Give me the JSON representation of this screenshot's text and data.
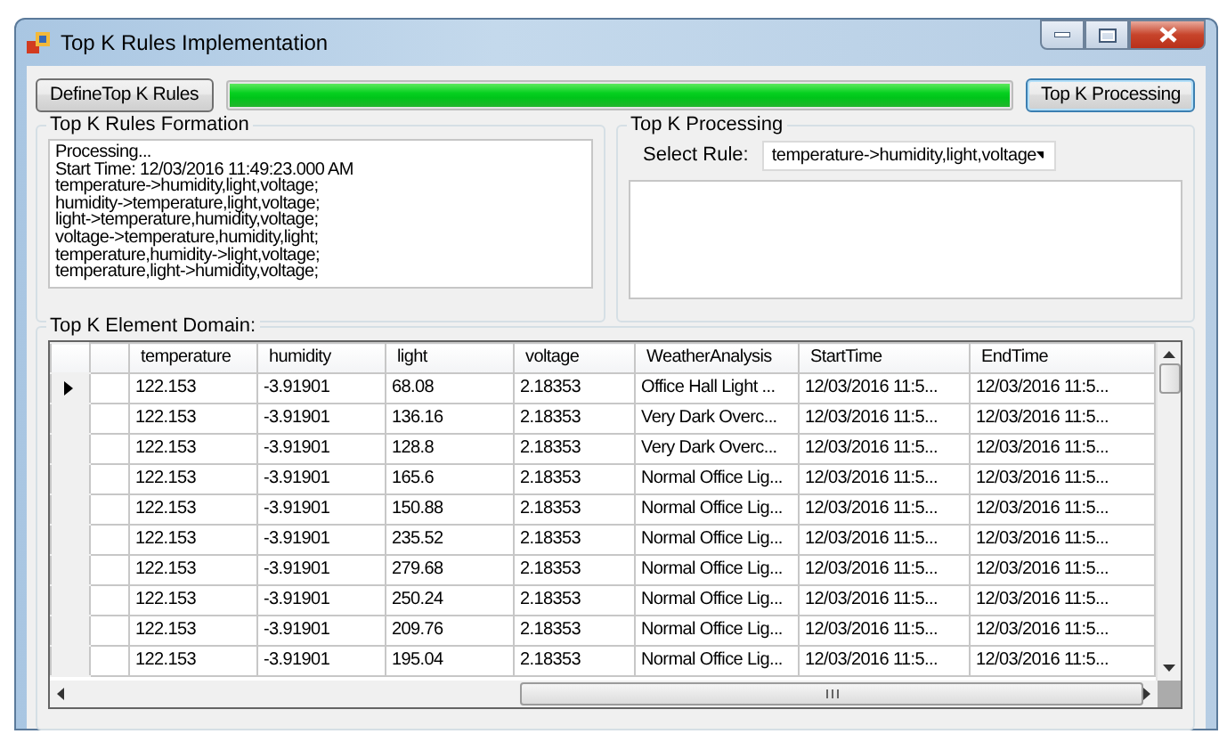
{
  "window": {
    "title": "Top K Rules Implementation"
  },
  "toolbar": [
    {
      "kind": "button",
      "label": "DefineTop K Rules",
      "focused": false
    },
    {
      "kind": "progress",
      "level": 1
    },
    {
      "kind": "button",
      "label": "Top K Processing",
      "focused": true
    }
  ],
  "rules_formation": {
    "title": "Top K Rules Formation",
    "log_lines": [
      "Processing...",
      "Start Time: 12/03/2016 11:49:23.000 AM",
      "temperature->humidity,light,voltage;",
      "humidity->temperature,light,voltage;",
      "light->temperature,humidity,voltage;",
      "voltage->temperature,humidity,light;",
      "temperature,humidity->light,voltage;",
      "temperature,light->humidity,voltage;"
    ]
  },
  "top_k_processing": {
    "title": "Top K Processing",
    "select_label": "Select Rule:",
    "select_value": "temperature->humidity,light,voltage"
  },
  "element_domain": {
    "title": "Top K Element Domain:",
    "table": {
      "columns": [
        "temperature",
        "humidity",
        "light",
        "voltage",
        "WeatherAnalysis",
        "StartTime",
        "EndTime"
      ],
      "rows": [
        {
          "current": true,
          "cells": [
            "122.153",
            "-3.91901",
            "68.08",
            "2.18353",
            "Office Hall Light ...",
            "12/03/2016 11:5...",
            "12/03/2016 11:5..."
          ]
        },
        {
          "current": false,
          "cells": [
            "122.153",
            "-3.91901",
            "136.16",
            "2.18353",
            "Very Dark Overc...",
            "12/03/2016 11:5...",
            "12/03/2016 11:5..."
          ]
        },
        {
          "current": false,
          "cells": [
            "122.153",
            "-3.91901",
            "128.8",
            "2.18353",
            "Very Dark Overc...",
            "12/03/2016 11:5...",
            "12/03/2016 11:5..."
          ]
        },
        {
          "current": false,
          "cells": [
            "122.153",
            "-3.91901",
            "165.6",
            "2.18353",
            "Normal Office Lig...",
            "12/03/2016 11:5...",
            "12/03/2016 11:5..."
          ]
        },
        {
          "current": false,
          "cells": [
            "122.153",
            "-3.91901",
            "150.88",
            "2.18353",
            "Normal Office Lig...",
            "12/03/2016 11:5...",
            "12/03/2016 11:5..."
          ]
        },
        {
          "current": false,
          "cells": [
            "122.153",
            "-3.91901",
            "235.52",
            "2.18353",
            "Normal Office Lig...",
            "12/03/2016 11:5...",
            "12/03/2016 11:5..."
          ]
        },
        {
          "current": false,
          "cells": [
            "122.153",
            "-3.91901",
            "279.68",
            "2.18353",
            "Normal Office Lig...",
            "12/03/2016 11:5...",
            "12/03/2016 11:5..."
          ]
        },
        {
          "current": false,
          "cells": [
            "122.153",
            "-3.91901",
            "250.24",
            "2.18353",
            "Normal Office Lig...",
            "12/03/2016 11:5...",
            "12/03/2016 11:5..."
          ]
        },
        {
          "current": false,
          "cells": [
            "122.153",
            "-3.91901",
            "209.76",
            "2.18353",
            "Normal Office Lig...",
            "12/03/2016 11:5...",
            "12/03/2016 11:5..."
          ]
        },
        {
          "current": false,
          "cells": [
            "122.153",
            "-3.91901",
            "195.04",
            "2.18353",
            "Normal Office Lig...",
            "12/03/2016 11:5...",
            "12/03/2016 11:5..."
          ]
        }
      ]
    }
  }
}
